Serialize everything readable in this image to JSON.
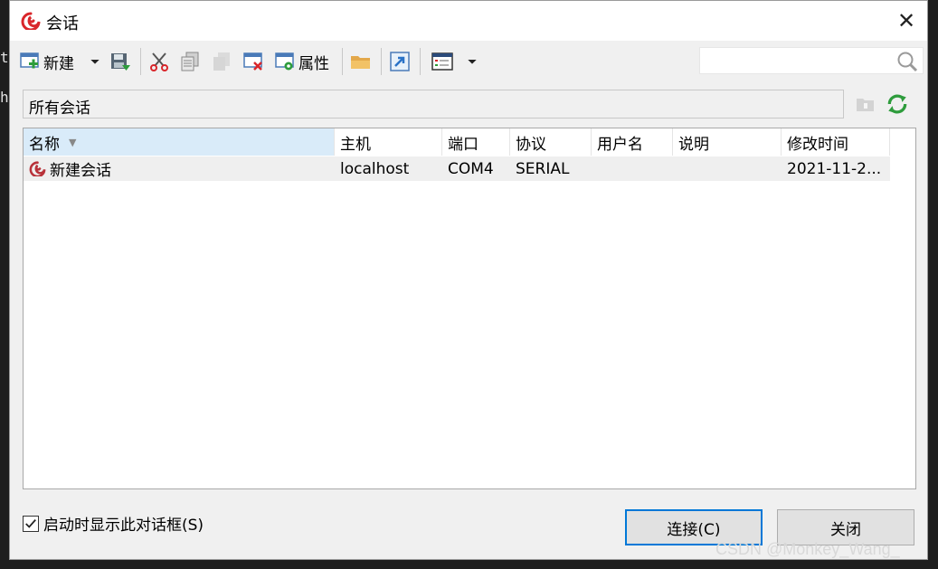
{
  "background": {
    "glyphs": [
      "t",
      "h"
    ]
  },
  "window": {
    "title": "会话",
    "close_symbol": "✕"
  },
  "toolbar": {
    "new_label": "新建",
    "properties_label": "属性"
  },
  "search": {
    "value": "",
    "placeholder": ""
  },
  "path_bar": {
    "text": "所有会话"
  },
  "columns": [
    "名称",
    "主机",
    "端口",
    "协议",
    "用户名",
    "说明",
    "修改时间"
  ],
  "sessions": [
    {
      "name": "新建会话",
      "host": "localhost",
      "port": "COM4",
      "protocol": "SERIAL",
      "username": "",
      "description": "",
      "modified": "2021-11-2..."
    }
  ],
  "footer": {
    "show_on_startup_label": "启动时显示此对话框(S)",
    "show_on_startup_checked": true,
    "connect_label": "连接(C)",
    "close_label": "关闭"
  },
  "watermark": "CSDN @Monkey_Wang_",
  "colors": {
    "accent": "#0078d7",
    "sorted_header": "#d9ebf9",
    "row_bg": "#efefef",
    "logo_red": "#d9262b",
    "refresh_green": "#2e9c3c"
  }
}
